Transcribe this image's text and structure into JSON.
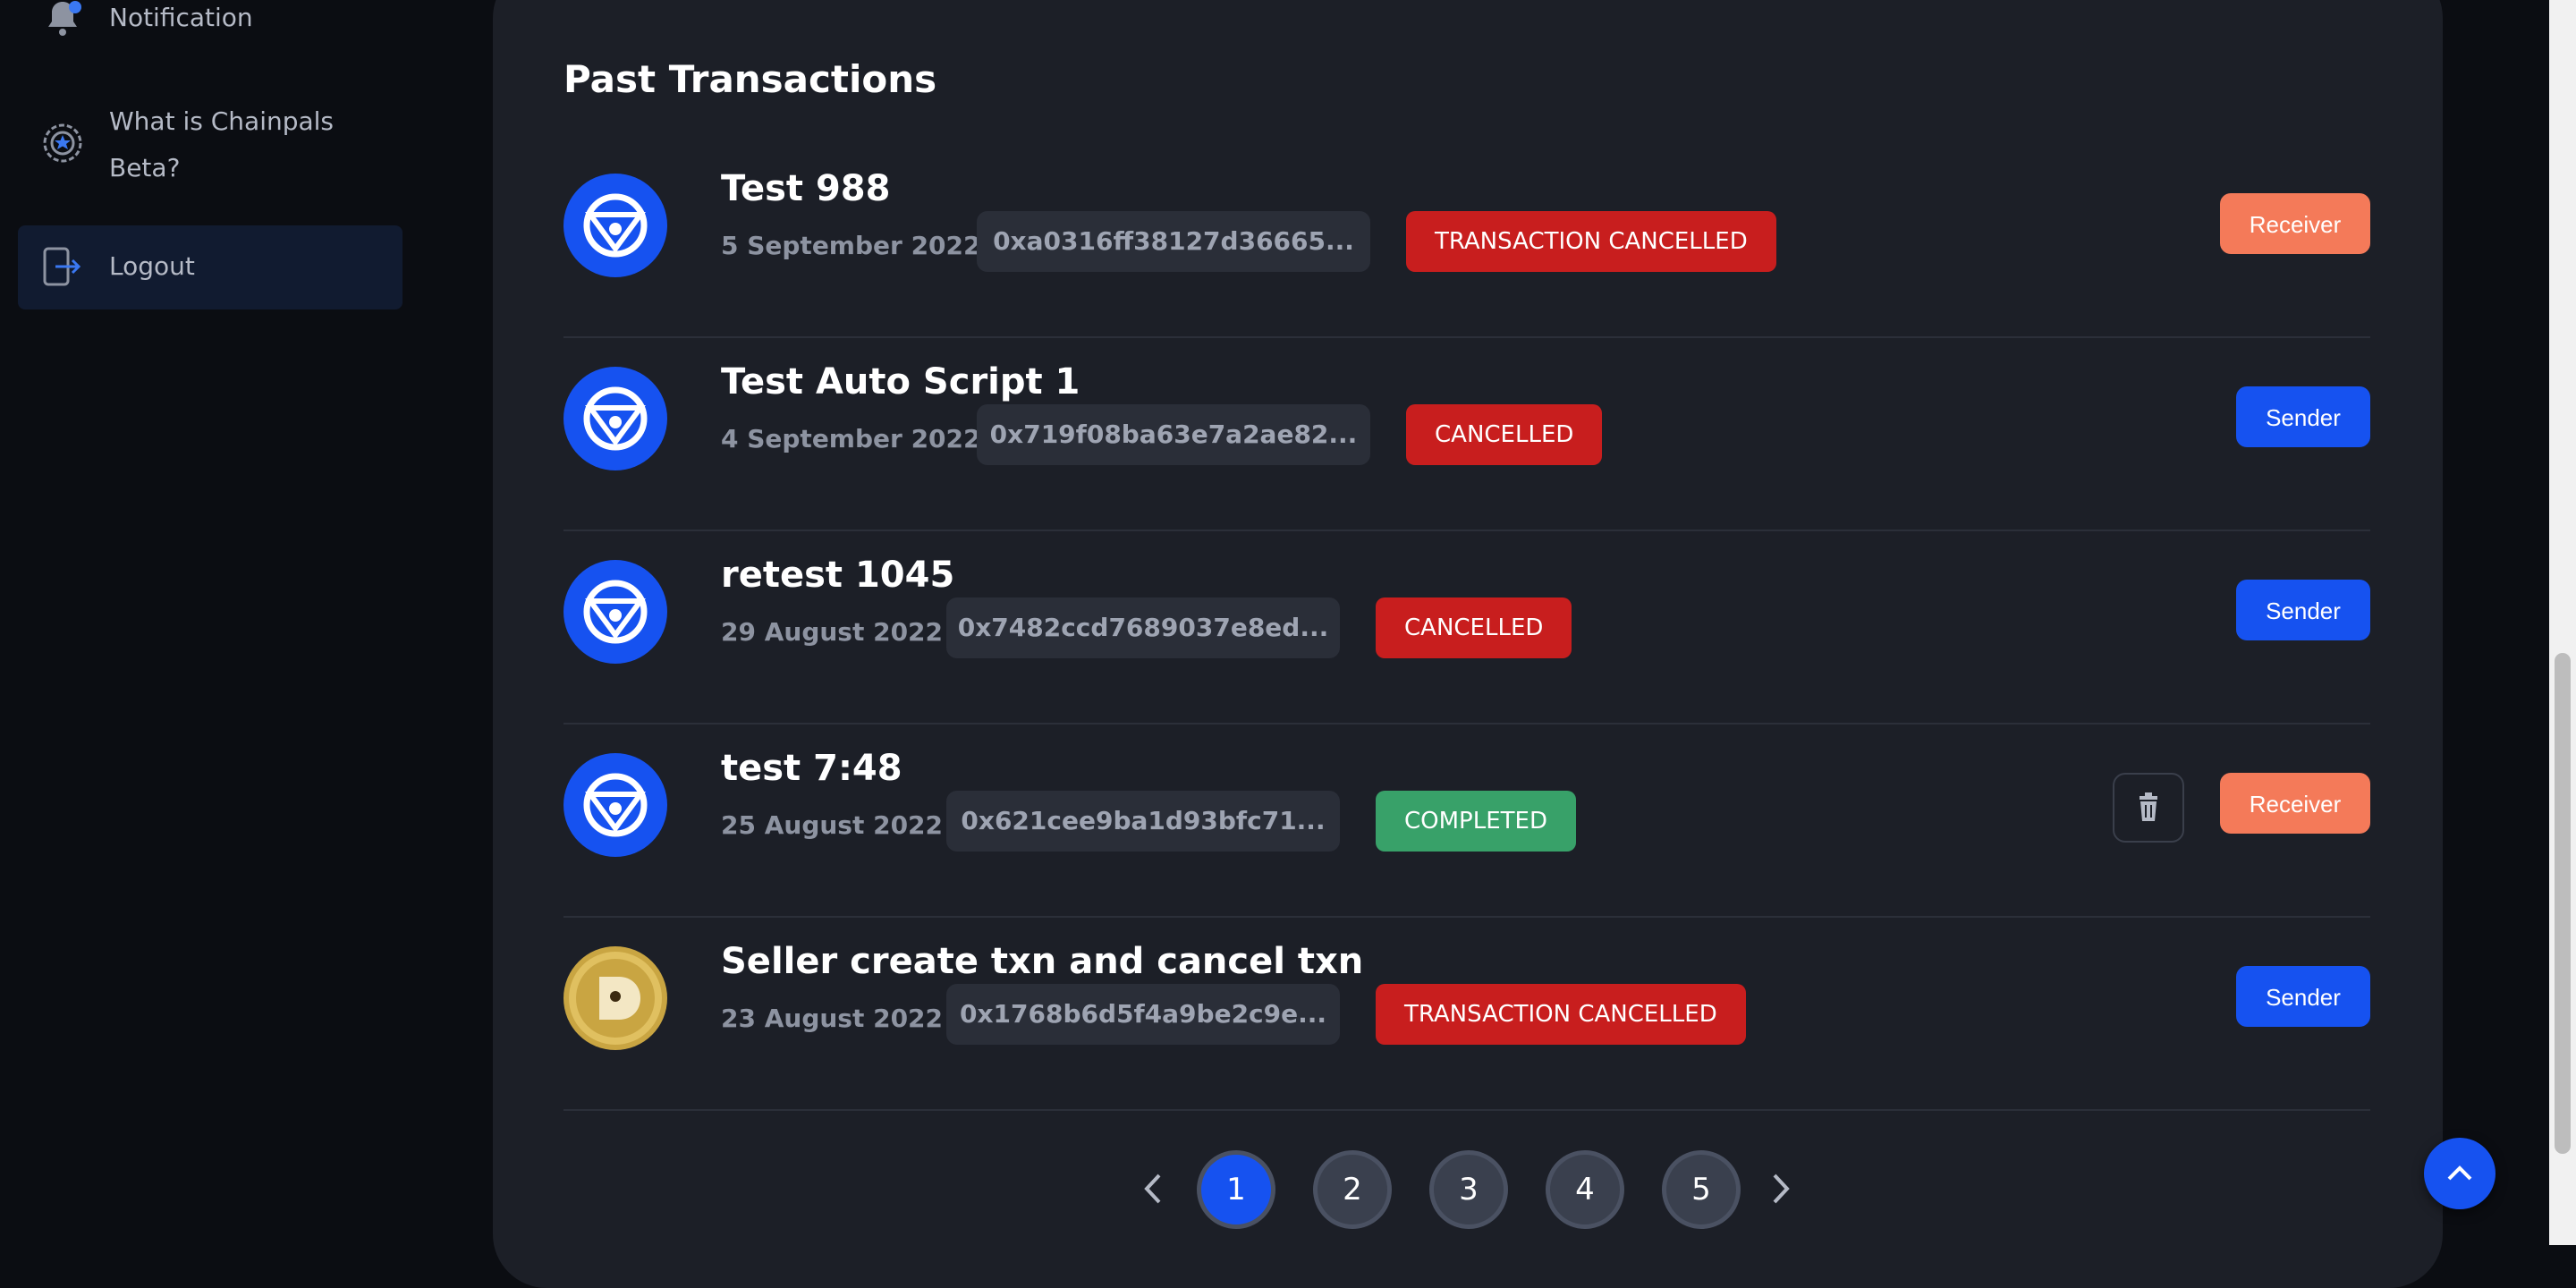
{
  "sidebar": {
    "items": [
      {
        "label": "Notification",
        "icon": "bell-icon"
      },
      {
        "label_line1": "What is Chainpals",
        "label_line2": "Beta?",
        "icon": "chainpals-beta-icon"
      },
      {
        "label": "Logout",
        "icon": "logout-icon"
      }
    ]
  },
  "main": {
    "title": "Past Transactions",
    "transactions": [
      {
        "title": "Test 988",
        "date": "5 September 2022",
        "hash": "0xa0316ff38127d36665...",
        "status": "TRANSACTION CANCELLED",
        "status_color": "#c81e1e",
        "role": "Receiver",
        "role_color": "#f47a59",
        "avatar": "chainpals-logo-icon"
      },
      {
        "title": "Test Auto Script 1",
        "date": "4 September 2022",
        "hash": "0x719f08ba63e7a2ae82...",
        "status": "CANCELLED",
        "status_color": "#c81e1e",
        "role": "Sender",
        "role_color": "#1652f0",
        "avatar": "chainpals-logo-icon"
      },
      {
        "title": "retest 1045",
        "date": "29 August 2022",
        "hash": "0x7482ccd7689037e8ed...",
        "status": "CANCELLED",
        "status_color": "#c81e1e",
        "role": "Sender",
        "role_color": "#1652f0",
        "avatar": "chainpals-logo-icon"
      },
      {
        "title": "test 7:48",
        "date": "25 August 2022",
        "hash": "0x621cee9ba1d93bfc71...",
        "status": "COMPLETED",
        "status_color": "#38a169",
        "role": "Receiver",
        "role_color": "#f47a59",
        "avatar": "chainpals-logo-icon",
        "has_delete": true
      },
      {
        "title": "Seller create txn and cancel txn",
        "date": "23 August 2022",
        "hash": "0x1768b6d5f4a9be2c9e...",
        "status": "TRANSACTION CANCELLED",
        "status_color": "#c81e1e",
        "role": "Sender",
        "role_color": "#1652f0",
        "avatar": "dogecoin-icon"
      }
    ]
  },
  "pagination": {
    "pages": [
      "1",
      "2",
      "3",
      "4",
      "5"
    ],
    "current": "1",
    "prev_icon": "chevron-left-icon",
    "next_icon": "chevron-right-icon"
  },
  "scroll_top_icon": "chevron-up-icon"
}
